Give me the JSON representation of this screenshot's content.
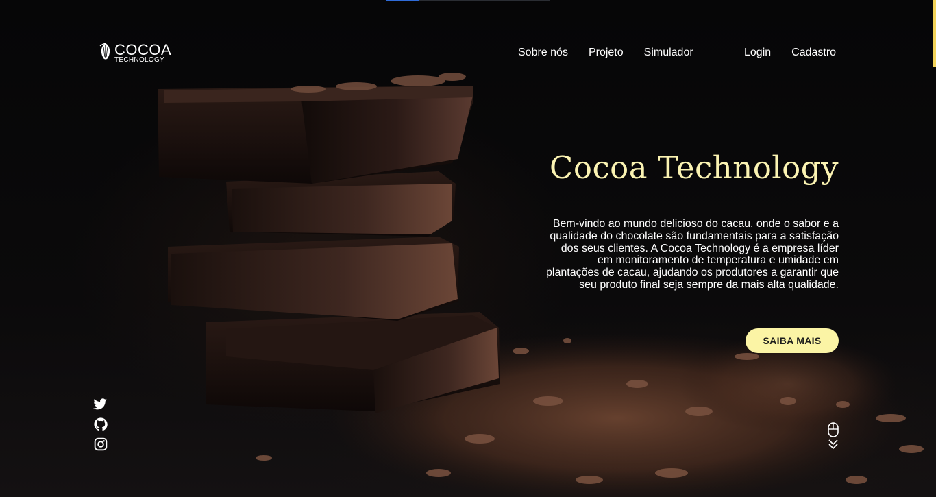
{
  "header": {
    "logo": {
      "main": "COCOA",
      "sub": "TECHNOLOGY",
      "icon": "cocoa-pod-icon"
    },
    "nav": [
      {
        "label": "Sobre nós"
      },
      {
        "label": "Projeto"
      },
      {
        "label": "Simulador"
      }
    ],
    "auth": [
      {
        "label": "Login"
      },
      {
        "label": "Cadastro"
      }
    ]
  },
  "hero": {
    "title": "Cocoa Technology",
    "description": "Bem-vindo ao mundo delicioso do cacau, onde o sabor e a qualidade do chocolate são fundamentais para a satisfação dos seus clientes. A Cocoa Technology é a empresa líder em monitoramento de temperatura e umidade em plantações de cacau, ajudando os produtores a garantir que seu produto final seja sempre da mais alta qualidade.",
    "cta_label": "SAIBA MAIS"
  },
  "socials": [
    {
      "icon": "twitter-icon"
    },
    {
      "icon": "github-icon"
    },
    {
      "icon": "instagram-icon"
    }
  ],
  "scroll_hint": {
    "icon": "mouse-scroll-icon"
  },
  "colors": {
    "background": "#070708",
    "title": "#fbf3b2",
    "cta_bg": "#fbf4a5",
    "text": "#ffffff",
    "chocolate": "#4a2e26"
  }
}
